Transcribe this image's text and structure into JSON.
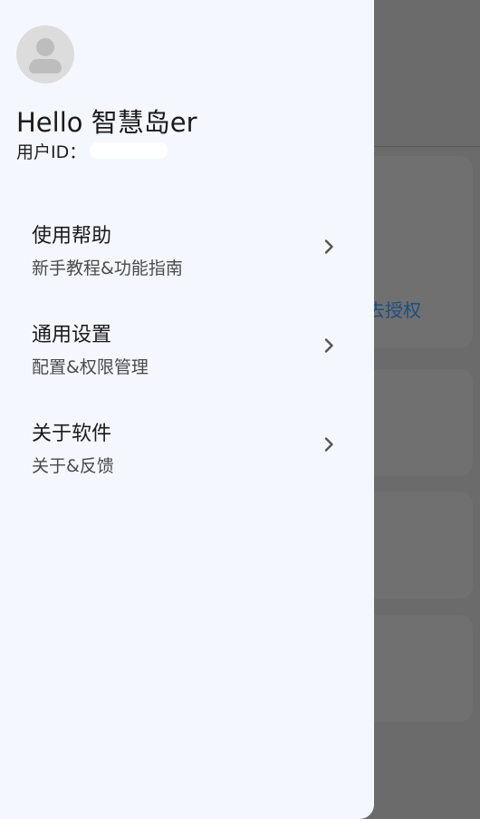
{
  "background": {
    "auth_link": "去授权"
  },
  "drawer": {
    "greeting": "Hello 智慧岛er",
    "user_id_label": "用户ID：",
    "menu": [
      {
        "title": "使用帮助",
        "subtitle": "新手教程&功能指南"
      },
      {
        "title": "通用设置",
        "subtitle": "配置&权限管理"
      },
      {
        "title": "关于软件",
        "subtitle": "关于&反馈"
      }
    ]
  },
  "colors": {
    "drawer_bg": "#f4f8fe",
    "scrim": "#6b6b6b",
    "link": "#1b4f7e"
  }
}
